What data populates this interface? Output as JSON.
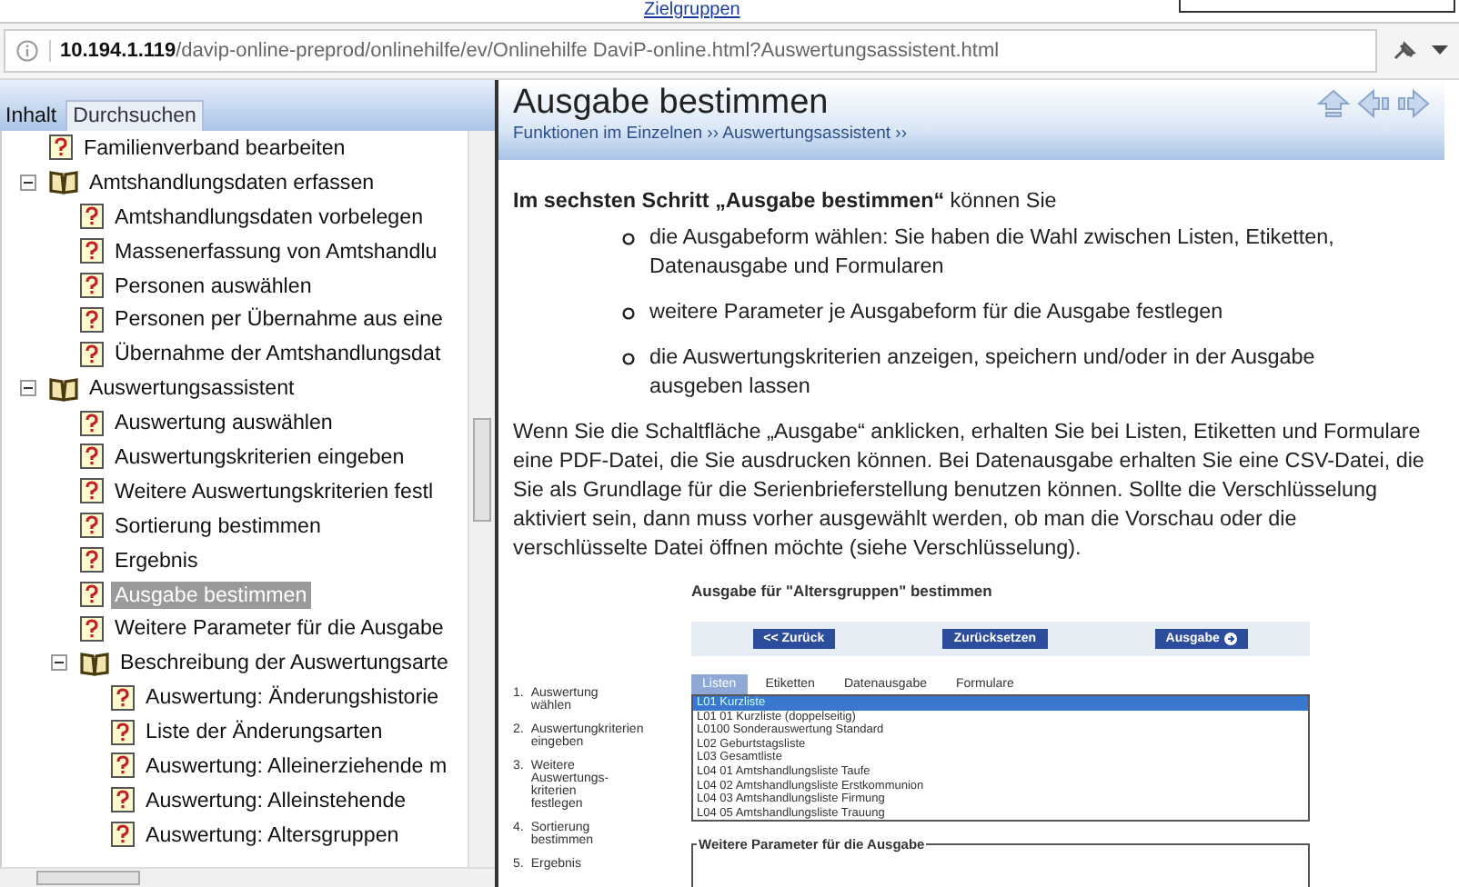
{
  "top_link": "Zielgruppen",
  "address_bar": {
    "url": "**10.194.1.119**/davip-online-preprod/onlinehilfe/ev/Onlinehilfe DaviP-online.html?Auswertungsassistent.html"
  },
  "tabs": [
    {
      "label": "Inhalt",
      "selected": true
    },
    {
      "label": "Durchsuchen",
      "selected": false
    }
  ],
  "tree": [
    {
      "kind": "page",
      "label": "Familienverband bearbeiten",
      "selected": false
    },
    {
      "kind": "book",
      "label": "Amtshandlungsdaten erfassen",
      "expanded": true,
      "children": [
        {
          "kind": "page",
          "label": "Amtshandlungsdaten vorbelegen",
          "selected": false
        },
        {
          "kind": "page",
          "label": "Massenerfassung von Amtshandlu",
          "selected": false
        },
        {
          "kind": "page",
          "label": "Personen auswählen",
          "selected": false
        },
        {
          "kind": "page",
          "label": "Personen per Übernahme aus eine",
          "selected": false
        },
        {
          "kind": "page",
          "label": "Übernahme der Amtshandlungsdat",
          "selected": false
        }
      ]
    },
    {
      "kind": "book",
      "label": "Auswertungsassistent",
      "expanded": true,
      "children": [
        {
          "kind": "page",
          "label": "Auswertung auswählen",
          "selected": false
        },
        {
          "kind": "page",
          "label": "Auswertungskriterien eingeben",
          "selected": false
        },
        {
          "kind": "page",
          "label": "Weitere Auswertungskriterien festl",
          "selected": false
        },
        {
          "kind": "page",
          "label": "Sortierung bestimmen",
          "selected": false
        },
        {
          "kind": "page",
          "label": "Ergebnis",
          "selected": false
        },
        {
          "kind": "page",
          "label": "Ausgabe bestimmen",
          "selected": true
        },
        {
          "kind": "page",
          "label": "Weitere Parameter für die Ausgabe",
          "selected": false
        },
        {
          "kind": "book",
          "label": "Beschreibung der Auswertungsarte",
          "expanded": true,
          "children": [
            {
              "kind": "page",
              "label": "Auswertung: Änderungshistorie",
              "selected": false
            },
            {
              "kind": "page",
              "label": "Liste der Änderungsarten",
              "selected": false
            },
            {
              "kind": "page",
              "label": "Auswertung: Alleinerziehende m",
              "selected": false
            },
            {
              "kind": "page",
              "label": "Auswertung: Alleinstehende",
              "selected": false
            },
            {
              "kind": "page",
              "label": "Auswertung: Altersgruppen",
              "selected": false
            }
          ]
        }
      ]
    }
  ],
  "topic": {
    "title": "Ausgabe bestimmen",
    "breadcrumb": "Funktionen im Einzelnen ›› Auswertungsassistent ››",
    "intro": "**Im sechsten Schritt „Ausgabe bestimmen“** können Sie",
    "bullets": [
      "die Ausgabeform wählen: Sie haben die Wahl zwischen Listen, Etiketten, Datenausgabe und Formularen",
      "weitere Parameter je Ausgabeform für die Ausgabe festlegen",
      "die Auswertungskriterien anzeigen, speichern und/oder in der Ausgabe ausgeben lassen"
    ],
    "paragraph": "Wenn Sie die Schaltfläche „Ausgabe“ anklicken, erhalten Sie bei Listen, Etiketten und Formulare eine PDF-Datei, die Sie ausdrucken können. Bei Datenausgabe erhalten Sie eine CSV-Datei, die Sie als Grundlage für die Serienbrieferstellung benutzen können. Sollte die Verschlüsselung aktiviert sein, dann muss vorher ausgewählt werden, ob man die Vorschau oder die verschlüsselte Datei öffnen möchte (siehe Verschlüsselung)."
  },
  "embedded_screenshot": {
    "title": "Ausgabe für \"Altersgruppen\" bestimmen",
    "steps": [
      {
        "number": "1.",
        "label": "Auswertung wählen"
      },
      {
        "number": "2.",
        "label": "Auswertungkriterien eingeben"
      },
      {
        "number": "3.",
        "label": "Weitere Auswertungs-kriterien festlegen"
      },
      {
        "number": "4.",
        "label": "Sortierung bestimmen"
      },
      {
        "number": "5.",
        "label": "Ergebnis"
      }
    ],
    "buttons": [
      "<< Zurück",
      "Zurücksetzen",
      "Ausgabe"
    ],
    "tabs": [
      {
        "label": "Listen",
        "selected": true
      },
      {
        "label": "Etiketten",
        "selected": false
      },
      {
        "label": "Datenausgabe",
        "selected": false
      },
      {
        "label": "Formulare",
        "selected": false
      }
    ],
    "list": [
      {
        "label": "L01 Kurzliste",
        "selected": true
      },
      {
        "label": "L01 01 Kurzliste (doppelseitig)",
        "selected": false
      },
      {
        "label": "L0100 Sonderauswertung Standard",
        "selected": false
      },
      {
        "label": "L02 Geburtstagsliste",
        "selected": false
      },
      {
        "label": "L03 Gesamtliste",
        "selected": false
      },
      {
        "label": "L04 01 Amtshandlungsliste Taufe",
        "selected": false
      },
      {
        "label": "L04 02 Amtshandlungsliste Erstkommunion",
        "selected": false
      },
      {
        "label": "L04 03 Amtshandlungsliste Firmung",
        "selected": false
      },
      {
        "label": "L04 05 Amtshandlungsliste Trauung",
        "selected": false
      }
    ],
    "fieldset_legend": "Weitere Parameter für die Ausgabe"
  }
}
